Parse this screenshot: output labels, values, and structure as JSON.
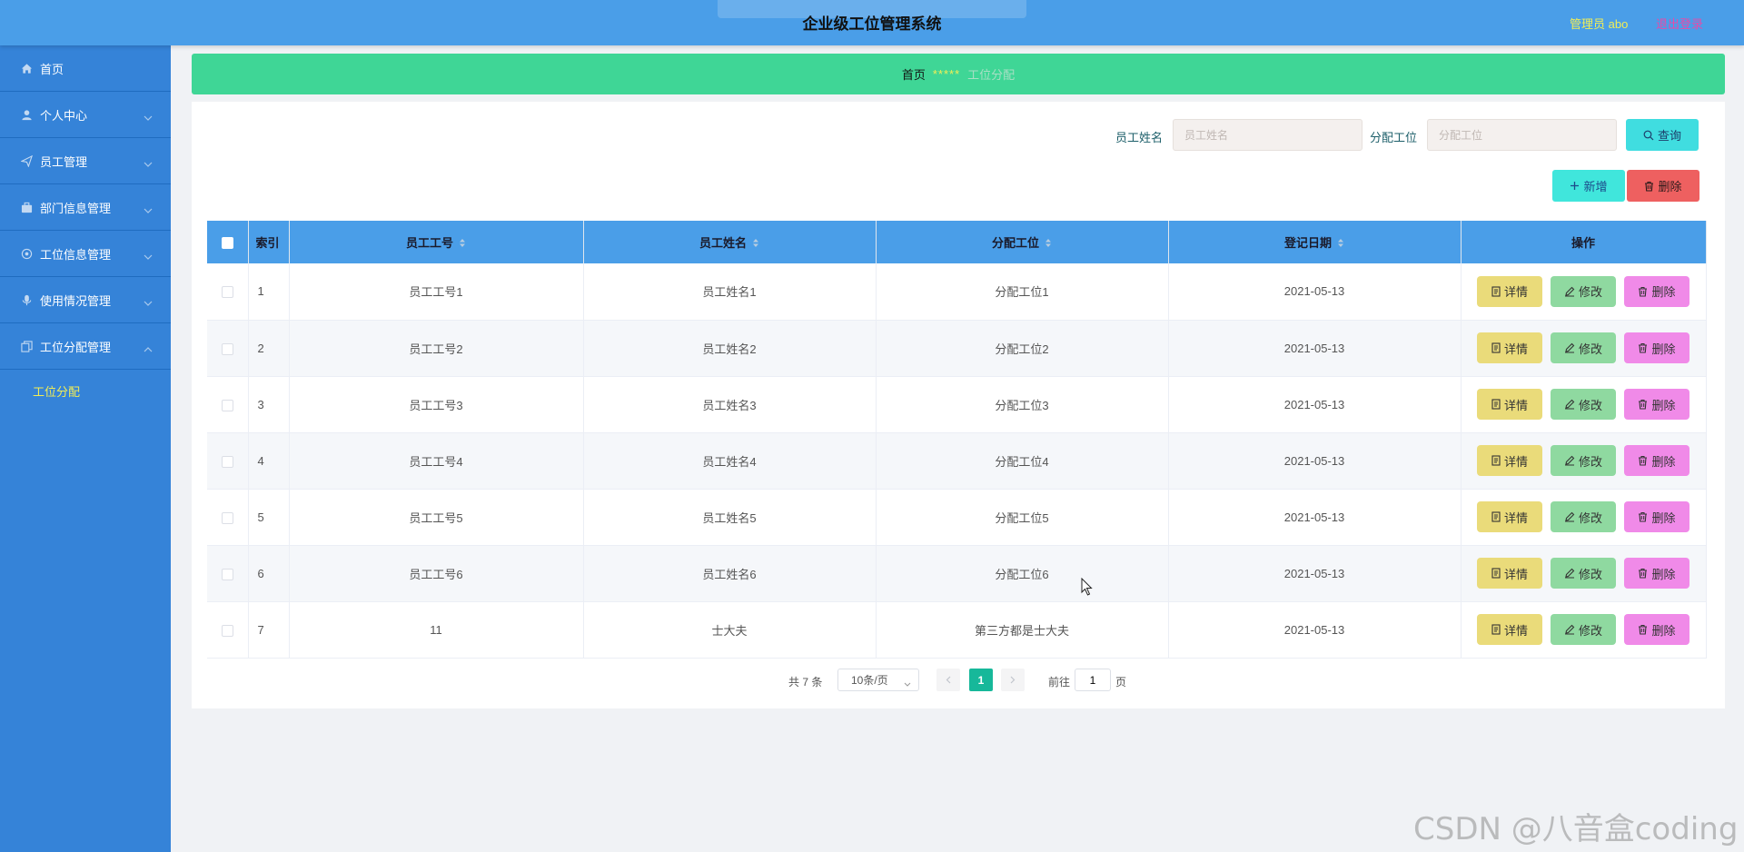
{
  "header": {
    "title": "企业级工位管理系统",
    "user": "管理员 abo",
    "logout": "退出登录"
  },
  "sidebar": {
    "items": [
      {
        "label": "首页",
        "icon": "home-icon"
      },
      {
        "label": "个人中心",
        "icon": "user-icon"
      },
      {
        "label": "员工管理",
        "icon": "send-icon"
      },
      {
        "label": "部门信息管理",
        "icon": "briefcase-icon"
      },
      {
        "label": "工位信息管理",
        "icon": "settings-icon"
      },
      {
        "label": "使用情况管理",
        "icon": "microphone-icon"
      },
      {
        "label": "工位分配管理",
        "icon": "copy-icon"
      }
    ],
    "submenu": {
      "label": "工位分配"
    }
  },
  "breadcrumb": {
    "home": "首页",
    "sep": "*****",
    "current": "工位分配"
  },
  "search": {
    "name_label": "员工姓名",
    "name_placeholder": "员工姓名",
    "station_label": "分配工位",
    "station_placeholder": "分配工位",
    "query": "查询"
  },
  "actions": {
    "add": "新增",
    "delete": "删除"
  },
  "table": {
    "headers": {
      "index": "索引",
      "emp_no": "员工工号",
      "emp_name": "员工姓名",
      "station": "分配工位",
      "date": "登记日期",
      "ops": "操作"
    },
    "op_labels": {
      "detail": "详情",
      "edit": "修改",
      "del": "删除"
    },
    "rows": [
      {
        "index": "1",
        "emp_no": "员工工号1",
        "emp_name": "员工姓名1",
        "station": "分配工位1",
        "date": "2021-05-13"
      },
      {
        "index": "2",
        "emp_no": "员工工号2",
        "emp_name": "员工姓名2",
        "station": "分配工位2",
        "date": "2021-05-13"
      },
      {
        "index": "3",
        "emp_no": "员工工号3",
        "emp_name": "员工姓名3",
        "station": "分配工位3",
        "date": "2021-05-13"
      },
      {
        "index": "4",
        "emp_no": "员工工号4",
        "emp_name": "员工姓名4",
        "station": "分配工位4",
        "date": "2021-05-13"
      },
      {
        "index": "5",
        "emp_no": "员工工号5",
        "emp_name": "员工姓名5",
        "station": "分配工位5",
        "date": "2021-05-13"
      },
      {
        "index": "6",
        "emp_no": "员工工号6",
        "emp_name": "员工姓名6",
        "station": "分配工位6",
        "date": "2021-05-13"
      },
      {
        "index": "7",
        "emp_no": "11",
        "emp_name": "士大夫",
        "station": "第三方都是士大夫",
        "date": "2021-05-13"
      }
    ]
  },
  "pagination": {
    "total": "共 7 条",
    "page_size": "10条/页",
    "current": "1",
    "goto": "前往",
    "goto_value": "1",
    "page_unit": "页"
  },
  "watermark": "CSDN @八音盒coding",
  "colors": {
    "header": "#4a9ee8",
    "sidebar": "#3583d8",
    "breadcrumb": "#3fd696",
    "accent": "#f2ee55"
  }
}
